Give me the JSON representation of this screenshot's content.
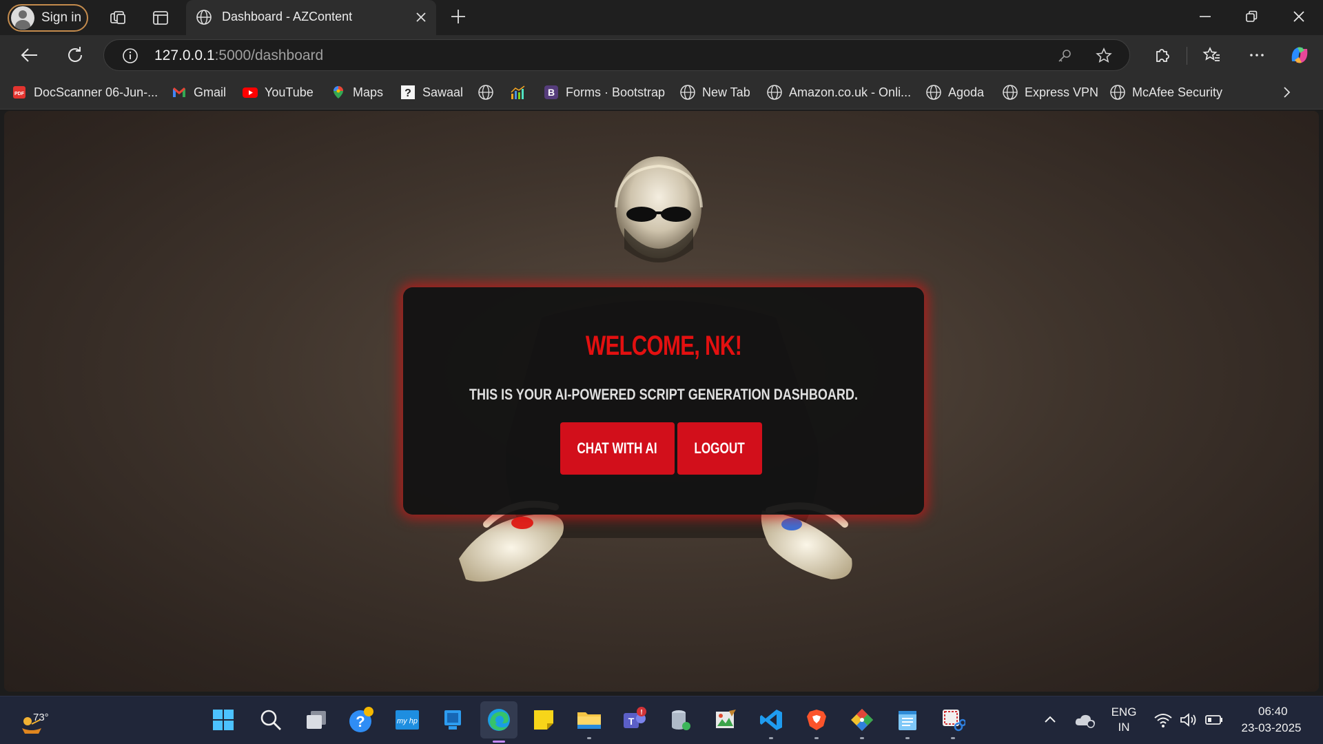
{
  "browser": {
    "signin_label": "Sign in",
    "tab_title": "Dashboard - AZContent",
    "url_host": "127.0.0.1",
    "url_path": ":5000/dashboard"
  },
  "bookmarks": [
    {
      "label": "DocScanner 06-Jun-...",
      "icon": "pdf-icon"
    },
    {
      "label": "Gmail",
      "icon": "gmail-icon"
    },
    {
      "label": "YouTube",
      "icon": "youtube-icon"
    },
    {
      "label": "Maps",
      "icon": "maps-icon"
    },
    {
      "label": "Sawaal",
      "icon": "sawaal-icon"
    },
    {
      "label": "",
      "icon": "globe-icon"
    },
    {
      "label": "",
      "icon": "chart-icon"
    },
    {
      "label": "Forms · Bootstrap",
      "icon": "bootstrap-icon"
    },
    {
      "label": "New Tab",
      "icon": "globe-icon"
    },
    {
      "label": "Amazon.co.uk - Onli...",
      "icon": "globe-icon"
    },
    {
      "label": "Agoda",
      "icon": "globe-icon"
    },
    {
      "label": "Express VPN",
      "icon": "globe-icon"
    },
    {
      "label": "McAfee Security",
      "icon": "globe-icon"
    }
  ],
  "dashboard": {
    "heading": "WELCOME, NK!",
    "subtitle": "THIS IS YOUR AI-POWERED SCRIPT GENERATION DASHBOARD.",
    "chat_button": "CHAT WITH AI",
    "logout_button": "LOGOUT",
    "accent_color": "#d20f1b"
  },
  "taskbar": {
    "weather_temp": "73°",
    "language_top": "ENG",
    "language_bottom": "IN",
    "time": "06:40",
    "date": "23-03-2025"
  }
}
